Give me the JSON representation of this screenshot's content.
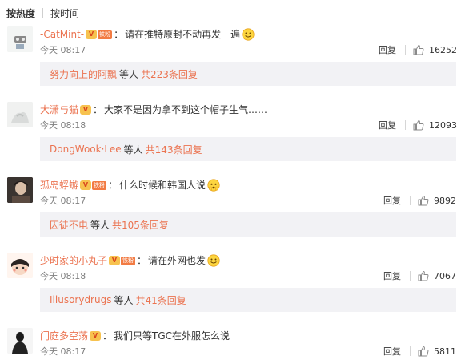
{
  "tabs": [
    {
      "label": "按热度",
      "active": true
    },
    {
      "label": "按时间",
      "active": false
    }
  ],
  "icons": {
    "like": "thumbs-up-icon",
    "emoji": "smiley-emoji-icon",
    "vip": "vip-badge-icon"
  },
  "colors": {
    "username": "#eb7350",
    "reply_bg": "#f2f2f5",
    "badge": "#f7c24f"
  },
  "comments": [
    {
      "username": "-CatMint-",
      "vip": "V",
      "fan_label": "铁粉",
      "separator": "：",
      "text": "请在推特原封不动再发一遍",
      "time": "今天 08:17",
      "reply_label": "回复",
      "likes": "16252",
      "reply_preview": {
        "user": "努力向上的阿飘",
        "etc": "等人",
        "count": "共223条回复"
      }
    },
    {
      "username": "大潇与猫",
      "vip": "V",
      "fan_label": "",
      "separator": "：",
      "text": "大家不是因为拿不到这个帽子生气……",
      "time": "今天 08:18",
      "reply_label": "回复",
      "likes": "12093",
      "reply_preview": {
        "user": "DongWook·Lee",
        "etc": "等人",
        "count": "共143条回复"
      }
    },
    {
      "username": "孤岛蜉蝣",
      "vip": "V",
      "fan_label": "铁粉",
      "separator": "：",
      "text": "什么时候和韩国人说",
      "time": "今天 08:17",
      "reply_label": "回复",
      "likes": "9892",
      "reply_preview": {
        "user": "囚徒不电",
        "etc": "等人",
        "count": "共105条回复"
      }
    },
    {
      "username": "少时家的小丸子",
      "vip": "V",
      "fan_label": "铁粉",
      "separator": "：",
      "text": "请在外网也发",
      "time": "今天 08:18",
      "reply_label": "回复",
      "likes": "7067",
      "reply_preview": {
        "user": "Illusorydrugs",
        "etc": "等人",
        "count": "共41条回复"
      }
    },
    {
      "username": "门庭多空荡",
      "vip": "V",
      "fan_label": "",
      "separator": "：",
      "text": "我们只等TGC在外服怎么说",
      "time": "今天 08:17",
      "reply_label": "回复",
      "likes": "5811"
    }
  ]
}
